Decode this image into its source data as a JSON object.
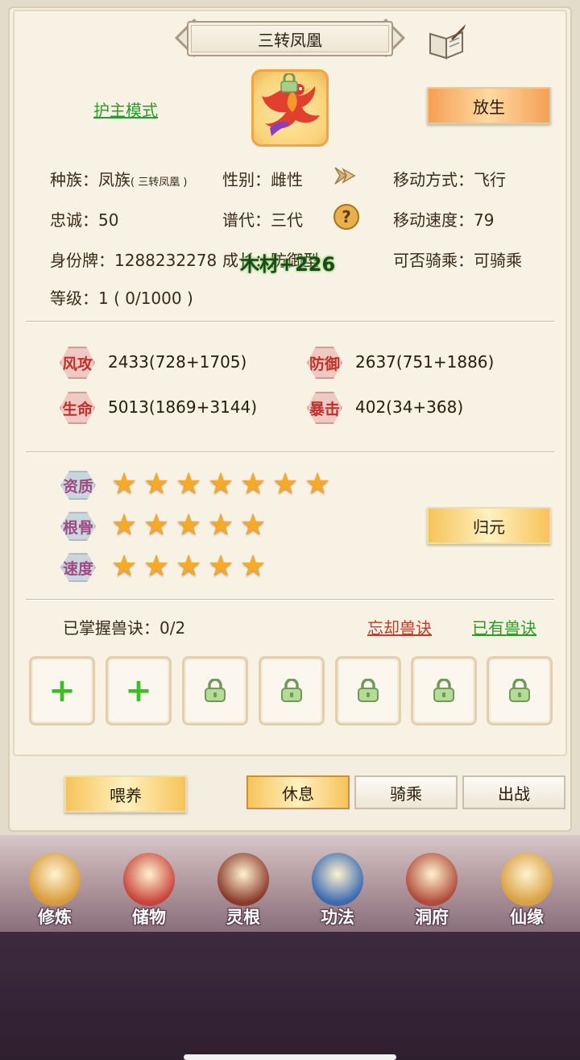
{
  "title": "三转凤凰",
  "mode_link": "护主模式",
  "release_button": "放生",
  "info": {
    "race_label": "种族：凤族",
    "race_sub": "( 三转凤凰 )",
    "gender": "性别：雌性",
    "move_type": "移动方式：飞行",
    "loyalty": "忠诚：50",
    "generation": "谱代：三代",
    "move_speed": "移动速度：79",
    "id_tag": "身份牌：1288232278",
    "growth": "成长：防御型",
    "rideable": "可否骑乘：可骑乘",
    "level": "等级：1 ( 0/1000 )"
  },
  "float_text": "木材+226",
  "stats": [
    {
      "label": "风攻",
      "value": "2433(728+1705)"
    },
    {
      "label": "防御",
      "value": "2637(751+1886)"
    },
    {
      "label": "生命",
      "value": "5013(1869+3144)"
    },
    {
      "label": "暴击",
      "value": "402(34+368)"
    }
  ],
  "attributes": [
    {
      "label": "资质",
      "stars": 7
    },
    {
      "label": "根骨",
      "stars": 5
    },
    {
      "label": "速度",
      "stars": 5
    }
  ],
  "return_button": "归元",
  "skills": {
    "mastered": "已掌握兽诀：0/2",
    "forget_link": "忘却兽诀",
    "owned_link": "已有兽诀",
    "slots": [
      "add",
      "add",
      "locked",
      "locked",
      "locked",
      "locked",
      "locked"
    ]
  },
  "actions": {
    "feed": "喂养",
    "rest": "休息",
    "ride": "骑乘",
    "battle": "出战",
    "active_tab": "rest"
  },
  "nav": [
    {
      "label": "修炼",
      "icon": "cultivation-monk-icon"
    },
    {
      "label": "储物",
      "icon": "storage-bag-icon"
    },
    {
      "label": "灵根",
      "icon": "spirit-root-icon"
    },
    {
      "label": "功法",
      "icon": "technique-book-icon"
    },
    {
      "label": "洞府",
      "icon": "cave-mansion-icon"
    },
    {
      "label": "仙缘",
      "icon": "immortal-fate-gourd-icon"
    }
  ],
  "colors": {
    "panel": "#f7f2e4",
    "accent_orange": "#f4a056",
    "star": "#f7a928",
    "link_green": "#2f9a2a",
    "link_red": "#c0392b"
  }
}
